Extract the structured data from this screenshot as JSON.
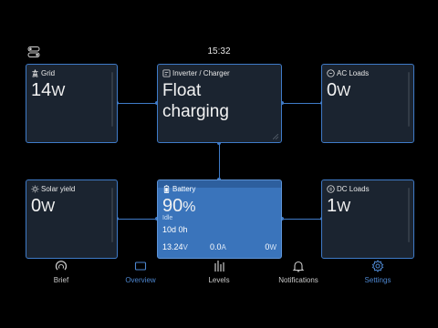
{
  "status_bar": {
    "time": "15:32"
  },
  "tiles": {
    "grid": {
      "title": "Grid",
      "value": "14",
      "unit": "W"
    },
    "inverter": {
      "title": "Inverter / Charger",
      "state_line1": "Float",
      "state_line2": "charging"
    },
    "ac_loads": {
      "title": "AC Loads",
      "value": "0",
      "unit": "W"
    },
    "solar": {
      "title": "Solar yield",
      "value": "0",
      "unit": "W"
    },
    "battery": {
      "title": "Battery",
      "soc": "90",
      "soc_unit": "%",
      "state": "Idle",
      "time_to_go": "10d 0h",
      "voltage": "13.24",
      "voltage_unit": "V",
      "current": "0.0",
      "current_unit": "A",
      "power": "0",
      "power_unit": "W"
    },
    "dc_loads": {
      "title": "DC Loads",
      "value": "1",
      "unit": "W"
    }
  },
  "nav": {
    "items": [
      {
        "label": "Brief",
        "icon": "brief-gauge-icon"
      },
      {
        "label": "Overview",
        "icon": "overview-icon"
      },
      {
        "label": "Levels",
        "icon": "levels-icon"
      },
      {
        "label": "Notifications",
        "icon": "bell-icon"
      },
      {
        "label": "Settings",
        "icon": "gear-icon"
      }
    ],
    "active": "Overview"
  },
  "colors": {
    "accent": "#3f7bc8",
    "tile_bg": "#1b2430",
    "battery_fill": "#3a74bb",
    "active_nav": "#4d86cf"
  }
}
